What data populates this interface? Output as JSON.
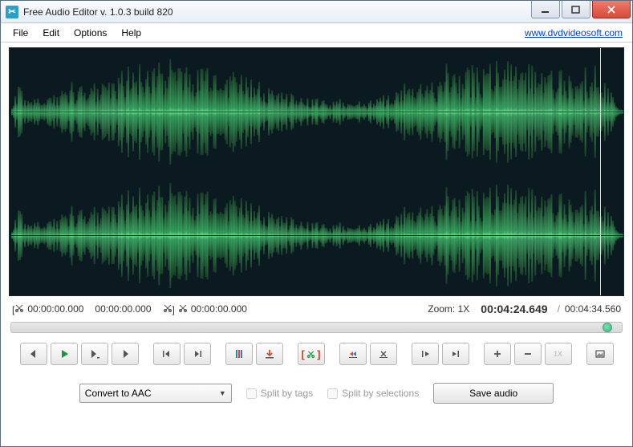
{
  "window": {
    "title": "Free Audio Editor v. 1.0.3 build 820"
  },
  "menu": {
    "file": "File",
    "edit": "Edit",
    "options": "Options",
    "help": "Help",
    "link": "www.dvdvideosoft.com"
  },
  "timebar": {
    "sel_start": "00:00:00.000",
    "sel_end": "00:00:00.000",
    "cursor": "00:00:00.000",
    "zoom_label": "Zoom:",
    "zoom_value": "1X",
    "position": "00:04:24.649",
    "duration": "00:04:34.560"
  },
  "toolbar": {
    "zoom_btn": "1X"
  },
  "bottom": {
    "convert_value": "Convert to AAC",
    "split_tags": "Split by tags",
    "split_selections": "Split by selections",
    "save": "Save audio"
  }
}
